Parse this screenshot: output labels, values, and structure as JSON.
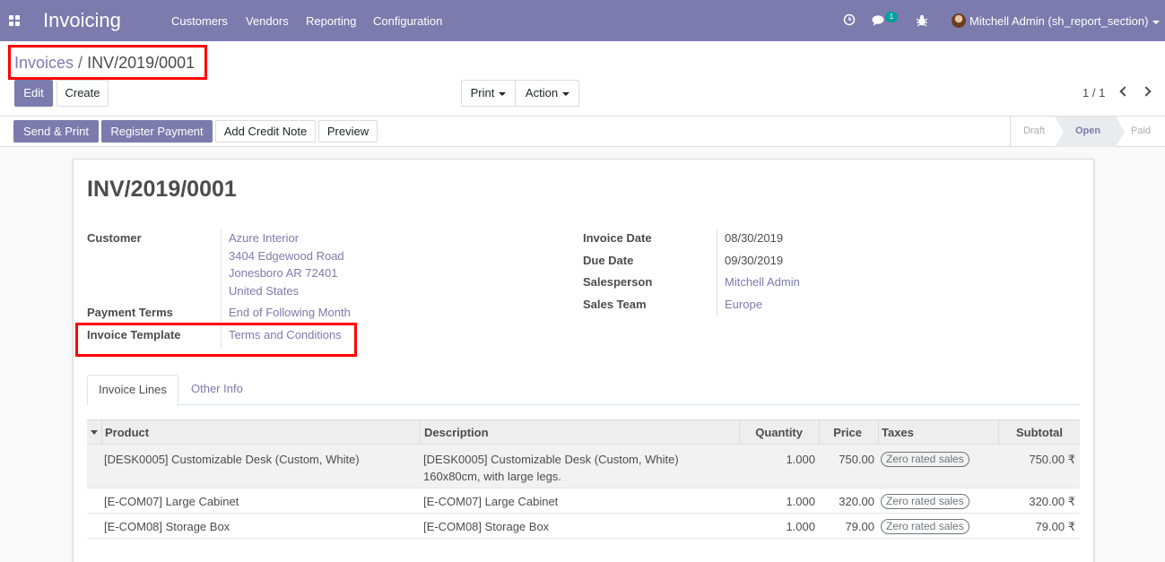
{
  "navbar": {
    "app_title": "Invoicing",
    "menu": [
      "Customers",
      "Vendors",
      "Reporting",
      "Configuration"
    ],
    "chat_badge": "1",
    "user_name": "Mitchell Admin (sh_report_section)",
    "icons": [
      "apps-icon",
      "clock-icon",
      "chat-icon",
      "bug-icon"
    ]
  },
  "breadcrumb": {
    "parent": "Invoices",
    "separator": "/",
    "current": "INV/2019/0001"
  },
  "buttons": {
    "edit": "Edit",
    "create": "Create",
    "print": "Print",
    "action": "Action"
  },
  "pager": {
    "value": "1 / 1"
  },
  "statusbar": {
    "actions": [
      "Send & Print",
      "Register Payment",
      "Add Credit Note",
      "Preview"
    ],
    "stages": [
      "Draft",
      "Open",
      "Paid"
    ],
    "current_stage": "Open"
  },
  "invoice": {
    "title": "INV/2019/0001",
    "left_fields": {
      "customer_label": "Customer",
      "customer_lines": [
        "Azure Interior",
        "3404 Edgewood Road",
        "Jonesboro AR 72401",
        "United States"
      ],
      "payment_terms_label": "Payment Terms",
      "payment_terms_value": "End of Following Month",
      "template_label": "Invoice Template",
      "template_value": "Terms and Conditions"
    },
    "right_fields": [
      {
        "label": "Invoice Date",
        "value": "08/30/2019"
      },
      {
        "label": "Due Date",
        "value": "09/30/2019"
      },
      {
        "label": "Salesperson",
        "value": "Mitchell Admin"
      },
      {
        "label": "Sales Team",
        "value": "Europe"
      }
    ]
  },
  "tabs": [
    "Invoice Lines",
    "Other Info"
  ],
  "table": {
    "headers": [
      "Product",
      "Description",
      "Quantity",
      "Price",
      "Taxes",
      "Subtotal"
    ],
    "rows": [
      {
        "product": "[DESK0005] Customizable Desk (Custom, White)",
        "description": "[DESK0005] Customizable Desk (Custom, White)",
        "description2": "160x80cm, with large legs.",
        "quantity": "1.000",
        "price": "750.00",
        "tax": "Zero rated sales",
        "subtotal": "750.00 ₹"
      },
      {
        "product": "[E-COM07] Large Cabinet",
        "description": "[E-COM07] Large Cabinet",
        "description2": "",
        "quantity": "1.000",
        "price": "320.00",
        "tax": "Zero rated sales",
        "subtotal": "320.00 ₹"
      },
      {
        "product": "[E-COM08] Storage Box",
        "description": "[E-COM08] Storage Box",
        "description2": "",
        "quantity": "1.000",
        "price": "79.00",
        "tax": "Zero rated sales",
        "subtotal": "79.00 ₹"
      }
    ]
  },
  "colors": {
    "brand": "#7c7bad",
    "highlight": "#ff0000",
    "teal": "#00a09d"
  }
}
